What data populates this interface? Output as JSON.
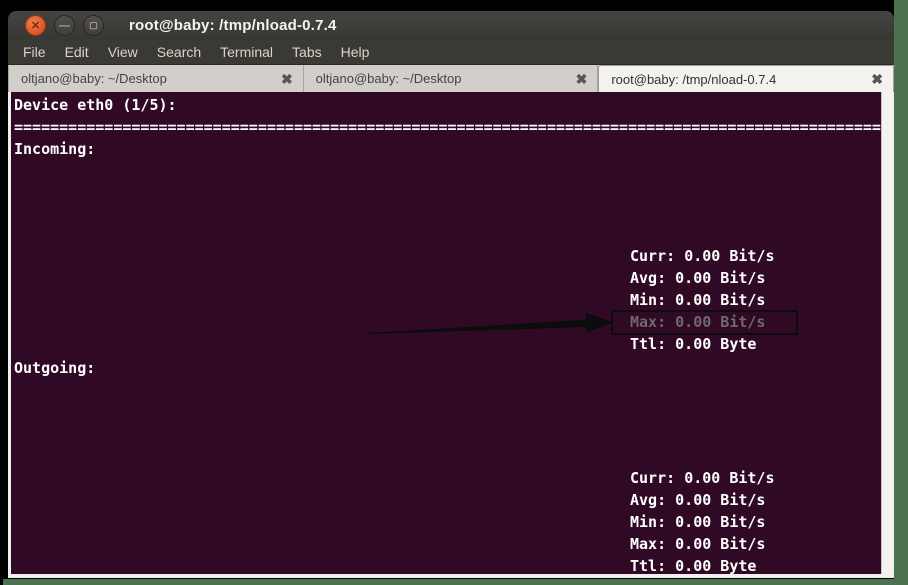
{
  "window": {
    "title": "root@baby: /tmp/nload-0.7.4",
    "buttons": {
      "close_glyph": "✕",
      "minimize_glyph": "—",
      "maximize_glyph": "▢"
    }
  },
  "menubar": {
    "items": [
      "File",
      "Edit",
      "View",
      "Search",
      "Terminal",
      "Tabs",
      "Help"
    ]
  },
  "tabbar": {
    "close_glyph": "✖",
    "tabs": [
      {
        "label": "oltjano@baby: ~/Desktop"
      },
      {
        "label": "oltjano@baby: ~/Desktop"
      },
      {
        "label": "root@baby: /tmp/nload-0.7.4"
      }
    ]
  },
  "terminal": {
    "device_header": "Device eth0 (1/5):",
    "separator": "================================================================================================",
    "incoming": {
      "section_label": "Incoming:",
      "stats": [
        {
          "label": "Curr:",
          "value": "0.00 Bit/s"
        },
        {
          "label": "Avg:",
          "value": "0.00 Bit/s"
        },
        {
          "label": "Min:",
          "value": "0.00 Bit/s"
        },
        {
          "label": "Max:",
          "value": "0.00 Bit/s",
          "highlighted": true
        },
        {
          "label": "Ttl:",
          "value": "0.00 Byte"
        }
      ]
    },
    "outgoing": {
      "section_label": "Outgoing:",
      "stats": [
        {
          "label": "Curr:",
          "value": "0.00 Bit/s"
        },
        {
          "label": "Avg:",
          "value": "0.00 Bit/s"
        },
        {
          "label": "Min:",
          "value": "0.00 Bit/s"
        },
        {
          "label": "Max:",
          "value": "0.00 Bit/s"
        },
        {
          "label": "Ttl:",
          "value": "0.00 Byte"
        }
      ]
    }
  },
  "colors": {
    "terminal_bg": "#300a24",
    "terminal_fg": "#ffffff",
    "dim_fg": "#6e6870",
    "titlebar_bg": "#3a3934",
    "tabbar_bg": "#d7d4d0",
    "desktop_edge": "#4d724f",
    "close_button": "#dd5226",
    "annotation": "#0c0c0c"
  }
}
